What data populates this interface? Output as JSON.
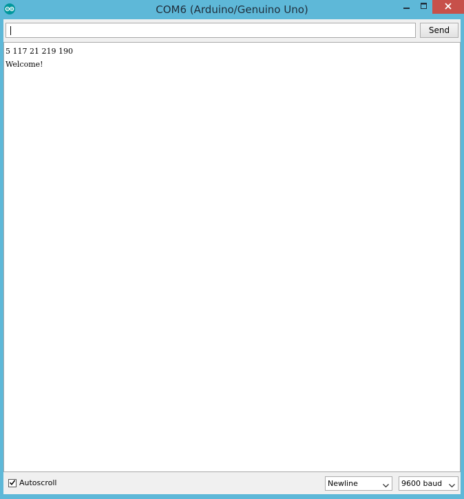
{
  "window": {
    "title": "COM6 (Arduino/Genuino Uno)"
  },
  "toolbar": {
    "input_value": "",
    "send_label": "Send"
  },
  "output": {
    "lines": [
      "5 117 21 219 190",
      "Welcome!"
    ]
  },
  "bottom": {
    "autoscroll_label": "Autoscroll",
    "autoscroll_checked": true,
    "line_ending": "Newline",
    "baud_rate": "9600 baud"
  },
  "icons": {
    "app": "arduino-logo-icon",
    "minimize": "minimize-icon",
    "maximize": "maximize-icon",
    "close": "close-icon",
    "check": "check-icon",
    "dropdown": "chevron-down-icon"
  },
  "colors": {
    "title_bar": "#5eb8d8",
    "close_button": "#c7504a",
    "arduino_teal": "#00979c"
  }
}
